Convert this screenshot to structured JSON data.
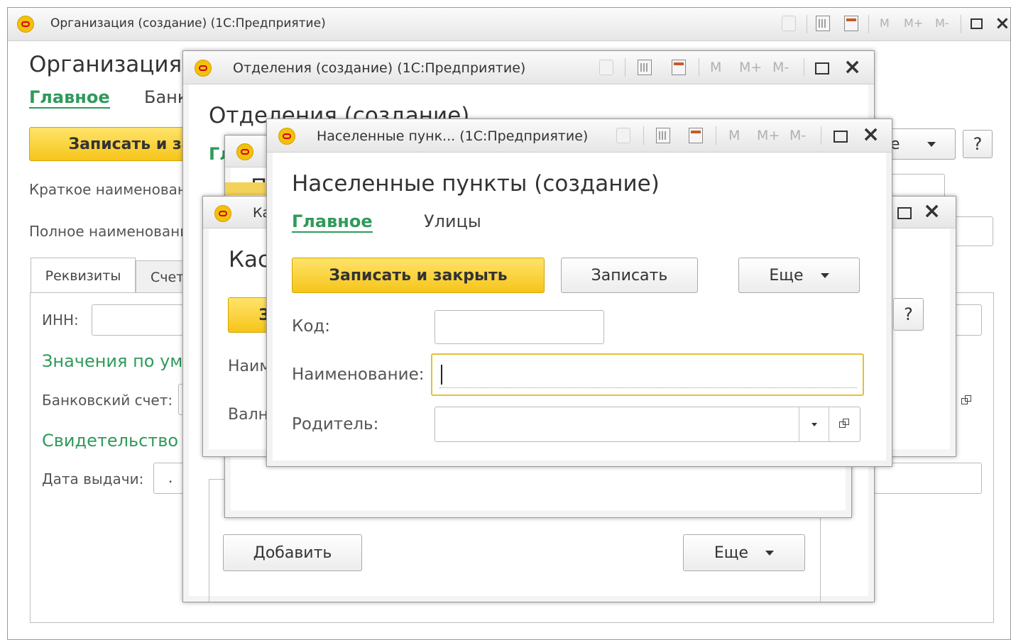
{
  "toolbar": {
    "m": "M",
    "mplus": "M+",
    "mminus": "M-",
    "calendar_day": "31"
  },
  "win_org": {
    "title": "Организация (создание)  (1С:Предприятие)",
    "heading": "Организация (",
    "tab_main": "Главное",
    "tab_bank": "Банк",
    "btn_write_close": "Записать и зак",
    "short_name_label": "Краткое наименован",
    "full_name_label": "Полное наименовани",
    "tab_details": "Реквизиты",
    "tab_accounts": "Счет",
    "inn_label": "ИНН:",
    "defaults_heading": "Значения по ум",
    "bank_account_label": "Банковский счет:",
    "certificate_heading": "Свидетельство",
    "issue_date_label": "Дата выдачи:",
    "issue_date_value": ".",
    "more_partial": "е",
    "help": "?"
  },
  "win_dept": {
    "title": "Отделения (создание)  (1С:Предприятие)",
    "heading": "Отделения (создание)",
    "tab_main_partial": "Гл",
    "btn_add": "Добавить",
    "btn_more": "Еще",
    "help": "?"
  },
  "win_hidden": {
    "heading_partial": "П"
  },
  "win_cash": {
    "title_partial": "Ка",
    "heading_partial": "Кас",
    "btn_partial": "З",
    "name_label_partial": "Наим",
    "currency_label_partial": "Валн"
  },
  "win_city": {
    "title": "Населенные пунк...  (1С:Предприятие)",
    "heading": "Населенные пункты (создание)",
    "tab_main": "Главное",
    "tab_streets": "Улицы",
    "btn_write_close": "Записать и закрыть",
    "btn_write": "Записать",
    "btn_more": "Еще",
    "code_label": "Код:",
    "name_label": "Наименование:",
    "parent_label": "Родитель:",
    "code_value": "",
    "name_value": "",
    "parent_value": ""
  }
}
